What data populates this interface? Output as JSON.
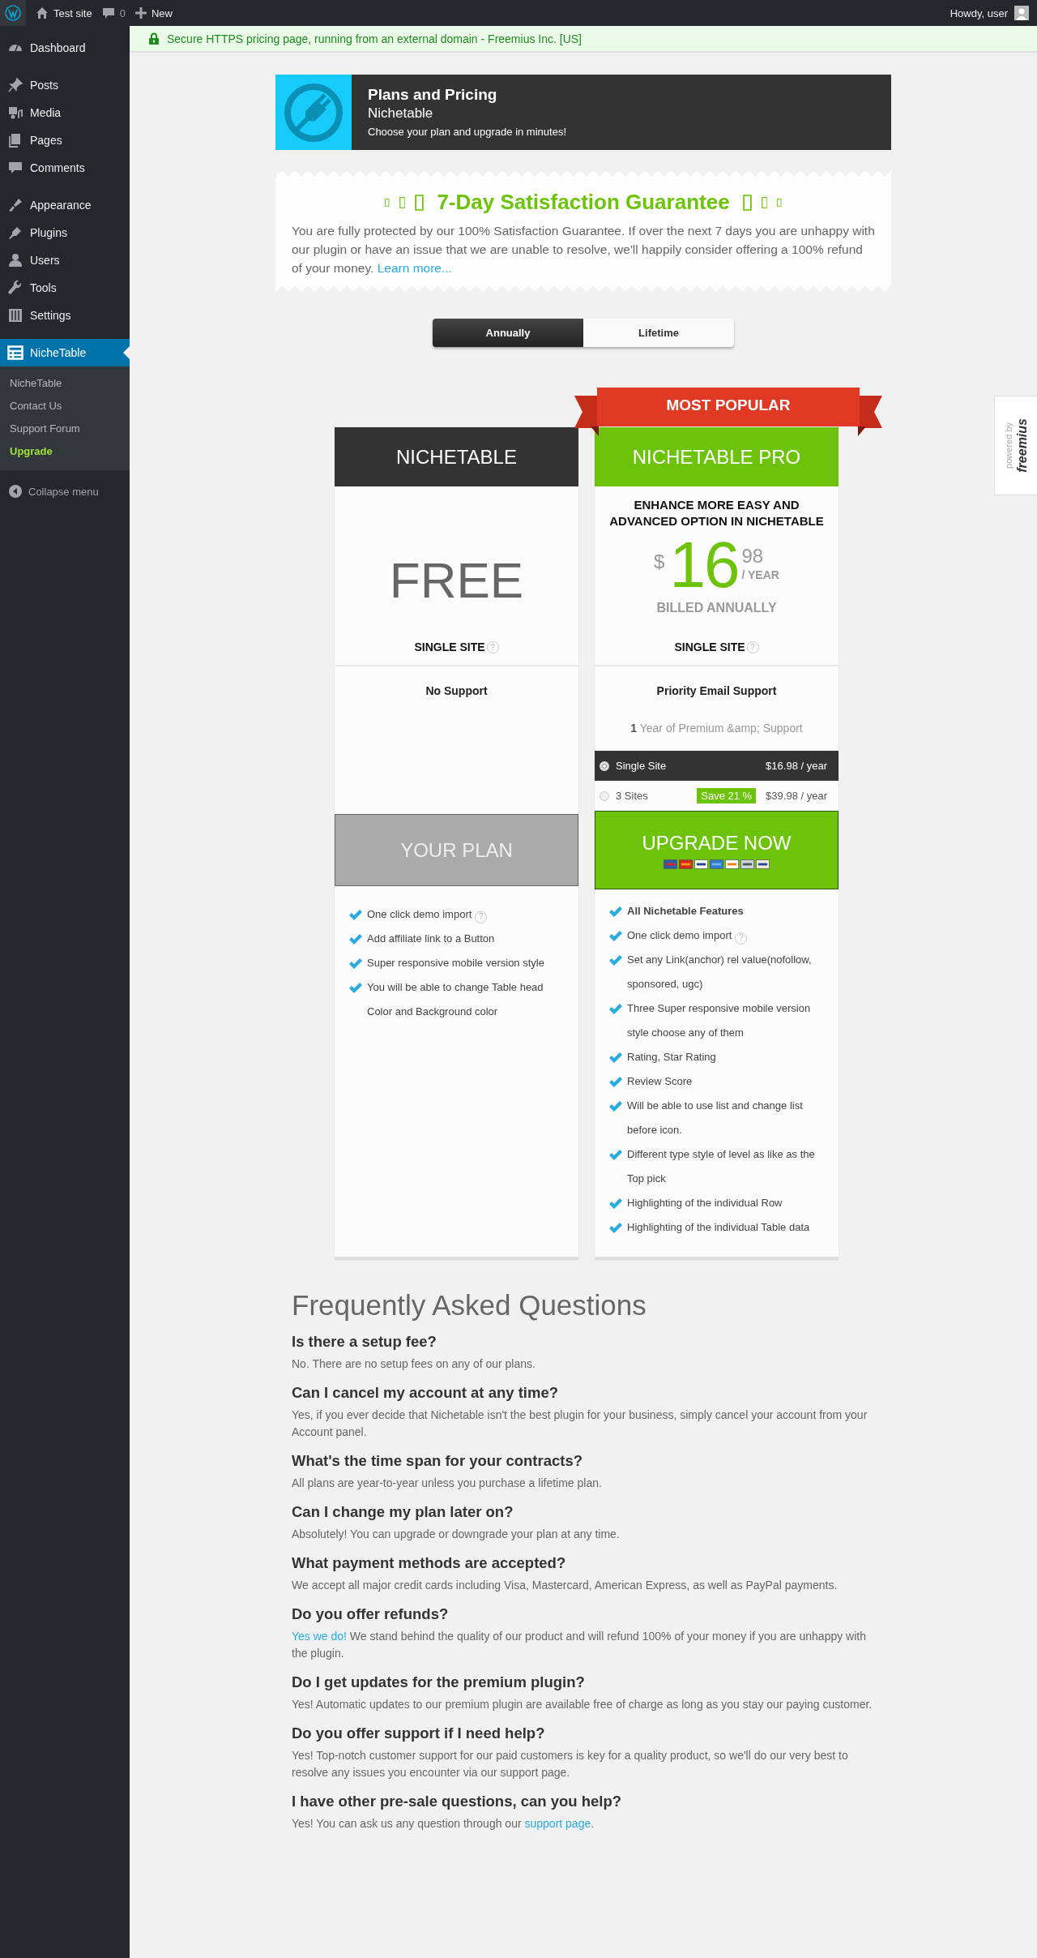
{
  "admin_bar": {
    "site": "Test site",
    "comments": "0",
    "new": "New",
    "greeting": "Howdy, user"
  },
  "sidebar": {
    "groups": [
      {
        "items": [
          {
            "label": "Dashboard",
            "selected": false
          }
        ]
      },
      {
        "items": [
          {
            "label": "Posts",
            "selected": false
          },
          {
            "label": "Media",
            "selected": false
          },
          {
            "label": "Pages",
            "selected": false
          },
          {
            "label": "Comments",
            "selected": false
          }
        ]
      },
      {
        "items": [
          {
            "label": "Appearance",
            "selected": false
          },
          {
            "label": "Plugins",
            "selected": false
          },
          {
            "label": "Users",
            "selected": false
          },
          {
            "label": "Tools",
            "selected": false
          },
          {
            "label": "Settings",
            "selected": false
          }
        ]
      },
      {
        "items": [
          {
            "label": "NicheTable",
            "selected": true,
            "submenu": [
              {
                "label": "NicheTable",
                "kind": "link"
              },
              {
                "label": "Contact Us",
                "kind": "link"
              },
              {
                "label": "Support Forum",
                "kind": "link"
              },
              {
                "label": "Upgrade",
                "kind": "upgrade"
              }
            ]
          }
        ]
      }
    ],
    "collapse": "Collapse menu"
  },
  "notice": {
    "text": "Secure HTTPS pricing page, running from an external domain - Freemius Inc. [US]"
  },
  "header": {
    "title": "Plans and Pricing",
    "product": "Nichetable",
    "subtitle": "Choose your plan and upgrade in minutes!"
  },
  "guarantee": {
    "title": "7-Day Satisfaction Guarantee",
    "text": "You are fully protected by our 100% Satisfaction Guarantee. If over the next 7 days you are unhappy with our plugin or have an issue that we are unable to resolve, we'll happily consider offering a 100% refund of your money.",
    "link": "Learn more..."
  },
  "billing_tabs": [
    {
      "label": "Annually",
      "selected": true
    },
    {
      "label": "Lifetime",
      "selected": false
    }
  ],
  "help_glyph": "?",
  "plans": [
    {
      "kind": "free",
      "name": "NICHETABLE",
      "price_label": "FREE",
      "license": "SINGLE SITE",
      "support": "No Support",
      "button": "YOUR PLAN",
      "features": [
        {
          "text": "One click demo import",
          "help": true,
          "bold": false
        },
        {
          "text": "Add affiliate link to a Button",
          "help": false,
          "bold": false
        },
        {
          "text": "Super responsive mobile version style",
          "help": false,
          "bold": false
        },
        {
          "text": "You will be able to change Table head Color and Background color",
          "help": false,
          "bold": false
        }
      ]
    },
    {
      "kind": "paid",
      "ribbon": "MOST POPULAR",
      "name": "NICHETABLE PRO",
      "description": "ENHANCE MORE EASY AND ADVANCED OPTION IN NICHETABLE",
      "currency": "$",
      "price_whole": "16",
      "price_cents": "98",
      "period": "/ YEAR",
      "billing": "BILLED ANNUALLY",
      "license": "SINGLE SITE",
      "support": "Priority Email Support",
      "renewal_count": "1",
      "renewal_text": "Year of Premium &amp; Support",
      "licenses": [
        {
          "label": "Single Site",
          "price": "$16.98 / year",
          "selected": true
        },
        {
          "label": "3 Sites",
          "badge": "Save 21 %",
          "price": "$39.98 / year",
          "selected": false
        }
      ],
      "button": "UPGRADE NOW",
      "features": [
        {
          "text": "All Nichetable Features",
          "help": false,
          "bold": true
        },
        {
          "text": "One click demo import",
          "help": true,
          "bold": false
        },
        {
          "text": "Set any Link(anchor) rel value(nofollow, sponsored, ugc)",
          "help": false,
          "bold": false
        },
        {
          "text": "Three Super responsive mobile version style choose any of them",
          "help": false,
          "bold": false
        },
        {
          "text": "Rating, Star Rating",
          "help": false,
          "bold": false
        },
        {
          "text": "Review Score",
          "help": false,
          "bold": false
        },
        {
          "text": "Will be able to use list and change list before icon.",
          "help": false,
          "bold": false
        },
        {
          "text": "Different type style of level as like as the Top pick",
          "help": false,
          "bold": false
        },
        {
          "text": "Highlighting of the individual Row",
          "help": false,
          "bold": false
        },
        {
          "text": "Highlighting of the individual Table data",
          "help": false,
          "bold": false
        }
      ]
    }
  ],
  "faq": {
    "title": "Frequently Asked Questions",
    "items": [
      {
        "question": "Is there a setup fee?",
        "answer": [
          {
            "kind": "text",
            "text": "No. There are no setup fees on any of our plans."
          }
        ]
      },
      {
        "question": "Can I cancel my account at any time?",
        "answer": [
          {
            "kind": "text",
            "text": "Yes, if you ever decide that Nichetable isn't the best plugin for your business, simply cancel your account from your Account panel."
          }
        ]
      },
      {
        "question": "What's the time span for your contracts?",
        "answer": [
          {
            "kind": "text",
            "text": "All plans are year-to-year unless you purchase a lifetime plan."
          }
        ]
      },
      {
        "question": "Can I change my plan later on?",
        "answer": [
          {
            "kind": "text",
            "text": "Absolutely! You can upgrade or downgrade your plan at any time."
          }
        ]
      },
      {
        "question": "What payment methods are accepted?",
        "answer": [
          {
            "kind": "text",
            "text": "We accept all major credit cards including Visa, Mastercard, American Express, as well as PayPal payments."
          }
        ]
      },
      {
        "question": "Do you offer refunds?",
        "answer": [
          {
            "kind": "link",
            "text": "Yes we do!"
          },
          {
            "kind": "text",
            "text": " We stand behind the quality of our product and will refund 100% of your money if you are unhappy with the plugin."
          }
        ]
      },
      {
        "question": "Do I get updates for the premium plugin?",
        "answer": [
          {
            "kind": "text",
            "text": "Yes! Automatic updates to our premium plugin are available free of charge as long as you stay our paying customer."
          }
        ]
      },
      {
        "question": "Do you offer support if I need help?",
        "answer": [
          {
            "kind": "text",
            "text": "Yes! Top-notch customer support for our paid customers is key for a quality product, so we'll do our very best to resolve any issues you encounter via our support page."
          }
        ]
      },
      {
        "question": "I have other pre-sale questions, can you help?",
        "answer": [
          {
            "kind": "text",
            "text": "Yes! You can ask us any question through our "
          },
          {
            "kind": "link",
            "text": "support page"
          },
          {
            "kind": "text",
            "text": "."
          }
        ]
      }
    ]
  },
  "badge": {
    "caption": "powered by",
    "brand": "freemius"
  }
}
